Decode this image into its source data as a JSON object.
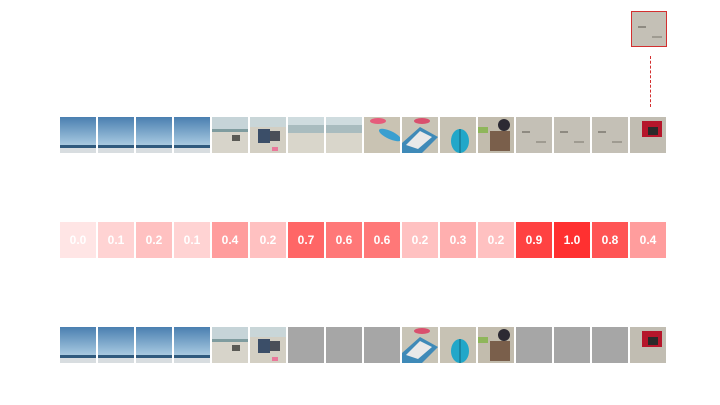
{
  "frames": [
    {
      "scene": "sky"
    },
    {
      "scene": "sky"
    },
    {
      "scene": "sky"
    },
    {
      "scene": "sky"
    },
    {
      "scene": "beach-horizon"
    },
    {
      "scene": "beach-chairs"
    },
    {
      "scene": "shoreline"
    },
    {
      "scene": "shoreline"
    },
    {
      "scene": "sand-surfboard"
    },
    {
      "scene": "towel-surfboard"
    },
    {
      "scene": "surfboard-blue"
    },
    {
      "scene": "bag-sand"
    },
    {
      "scene": "sand"
    },
    {
      "scene": "sand"
    },
    {
      "scene": "sand"
    },
    {
      "scene": "sand-object"
    }
  ],
  "scores": [
    "0.0",
    "0.1",
    "0.2",
    "0.1",
    "0.4",
    "0.2",
    "0.7",
    "0.6",
    "0.6",
    "0.2",
    "0.3",
    "0.2",
    "0.9",
    "1.0",
    "0.8",
    "0.4"
  ],
  "score_values": [
    0.0,
    0.1,
    0.2,
    0.1,
    0.4,
    0.2,
    0.7,
    0.6,
    0.6,
    0.2,
    0.3,
    0.2,
    0.9,
    1.0,
    0.8,
    0.4
  ],
  "kept": [
    true,
    true,
    true,
    true,
    true,
    true,
    false,
    false,
    false,
    true,
    true,
    true,
    false,
    false,
    false,
    true
  ],
  "highlighted_frame": 15,
  "colors": {
    "score_low": "#ffe5e5",
    "score_high": "#ff3030",
    "masked": "#a6a6a6",
    "highlight": "#d32f2f"
  }
}
